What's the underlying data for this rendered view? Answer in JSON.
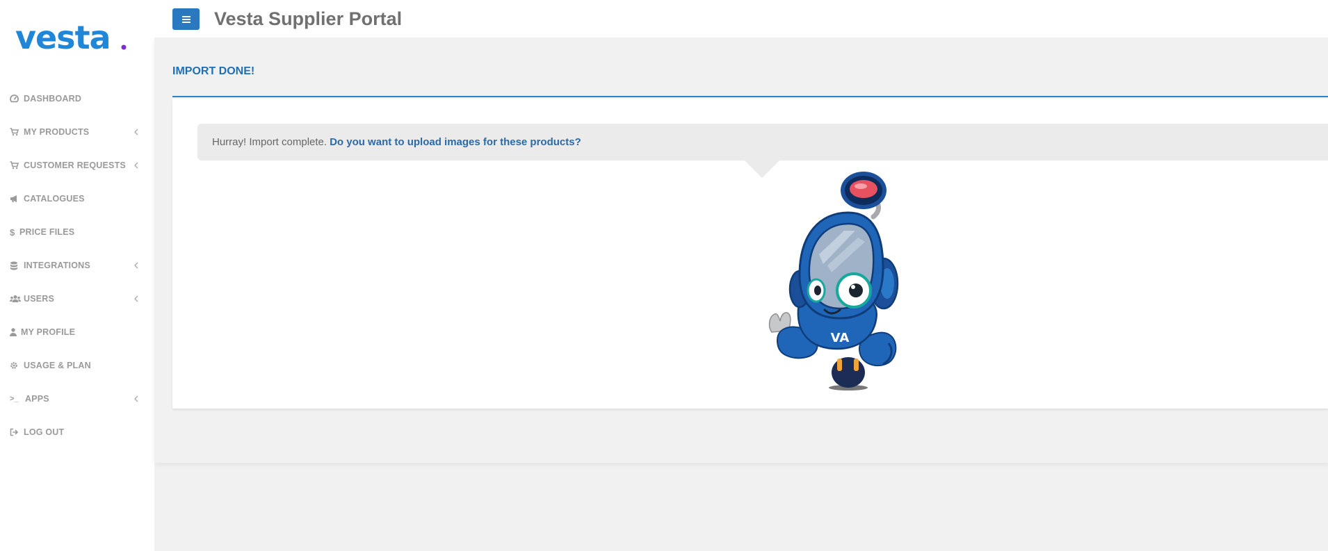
{
  "app": {
    "logo_text": "vesta",
    "brand_color": "#1f86d8",
    "accent_color": "#7b2fd1"
  },
  "sidebar": {
    "items": [
      {
        "label": "DASHBOARD",
        "icon": "dashboard-icon",
        "has_submenu": false
      },
      {
        "label": "MY PRODUCTS",
        "icon": "cart-icon",
        "has_submenu": true
      },
      {
        "label": "CUSTOMER REQUESTS",
        "icon": "cart-icon",
        "has_submenu": true
      },
      {
        "label": "CATALOGUES",
        "icon": "megaphone-icon",
        "has_submenu": false
      },
      {
        "label": "PRICE FILES",
        "icon": "dollar-icon",
        "has_submenu": false
      },
      {
        "label": "INTEGRATIONS",
        "icon": "database-icon",
        "has_submenu": true
      },
      {
        "label": "USERS",
        "icon": "users-icon",
        "has_submenu": true
      },
      {
        "label": "MY PROFILE",
        "icon": "user-icon",
        "has_submenu": false
      },
      {
        "label": "USAGE & PLAN",
        "icon": "gear-icon",
        "has_submenu": false
      },
      {
        "label": "APPS",
        "icon": "terminal-icon",
        "has_submenu": true
      },
      {
        "label": "LOG OUT",
        "icon": "logout-icon",
        "has_submenu": false
      }
    ]
  },
  "header": {
    "title": "Vesta Supplier Portal",
    "menu_toggle_icon": "hamburger-icon",
    "toggle_color": "#2a78c0"
  },
  "panel": {
    "title": "IMPORT DONE!",
    "message": "Hurray! Import complete.",
    "link_text": "Do you want to upload images for these products?",
    "title_color": "#1f6fb5"
  },
  "mascot": {
    "icon": "robot-mascot-icon",
    "badge_text": "VA"
  }
}
